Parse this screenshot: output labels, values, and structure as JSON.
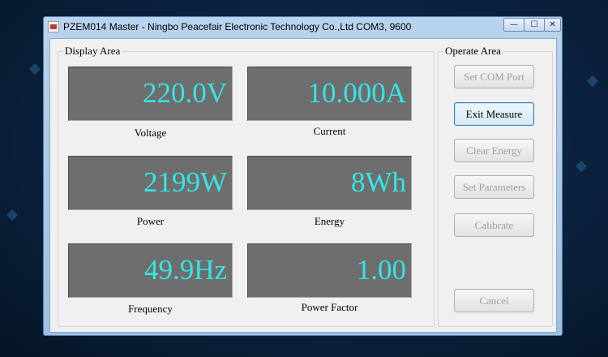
{
  "window": {
    "title": "PZEM014 Master - Ningbo Peacefair Electronic Technology Co.,Ltd  COM3, 9600",
    "controls": {
      "minimize": "—",
      "maximize": "☐",
      "close": "✕"
    }
  },
  "display_area": {
    "label": "Display Area",
    "readings": [
      {
        "value": "220.0V",
        "label": "Voltage"
      },
      {
        "value": "10.000A",
        "label": "Current"
      },
      {
        "value": "2199W",
        "label": "Power"
      },
      {
        "value": "8Wh",
        "label": "Energy"
      },
      {
        "value": "49.9Hz",
        "label": "Frequency"
      },
      {
        "value": "1.00",
        "label": "Power Factor"
      }
    ]
  },
  "operate_area": {
    "label": "Operate Area",
    "buttons": [
      {
        "label": "Set COM Port",
        "enabled": false
      },
      {
        "label": "Exit Measure",
        "enabled": true
      },
      {
        "label": "Clear Energy",
        "enabled": false
      },
      {
        "label": "Set Parameters",
        "enabled": false
      },
      {
        "label": "Calibrate",
        "enabled": false
      },
      {
        "label": "Cancel",
        "enabled": false
      }
    ]
  },
  "colors": {
    "display_text": "#33e6e6",
    "display_background": "#6e6e6e",
    "window_frame": "#b9d3ee"
  }
}
